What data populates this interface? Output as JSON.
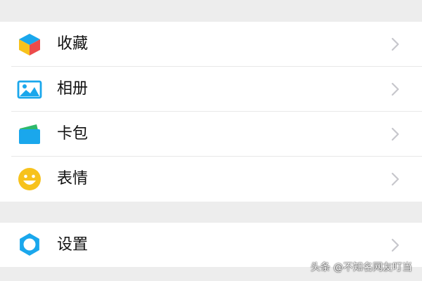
{
  "menu": {
    "group1": [
      {
        "label": "收藏",
        "icon": "favorites-cube-icon"
      },
      {
        "label": "相册",
        "icon": "album-picture-icon"
      },
      {
        "label": "卡包",
        "icon": "card-wallet-icon"
      },
      {
        "label": "表情",
        "icon": "smiley-sticker-icon"
      }
    ],
    "group2": [
      {
        "label": "设置",
        "icon": "settings-gear-icon"
      }
    ]
  },
  "watermark": "头条 @不知名网友叮当",
  "colors": {
    "background": "#ededed",
    "row": "#ffffff",
    "text": "#111111",
    "divider": "#e8e8e8",
    "chevron": "#c7c7cc",
    "icon_blue": "#1aa7ec",
    "icon_yellow": "#f7c21c",
    "icon_red": "#ec4b4b",
    "icon_green": "#2fb96b"
  }
}
